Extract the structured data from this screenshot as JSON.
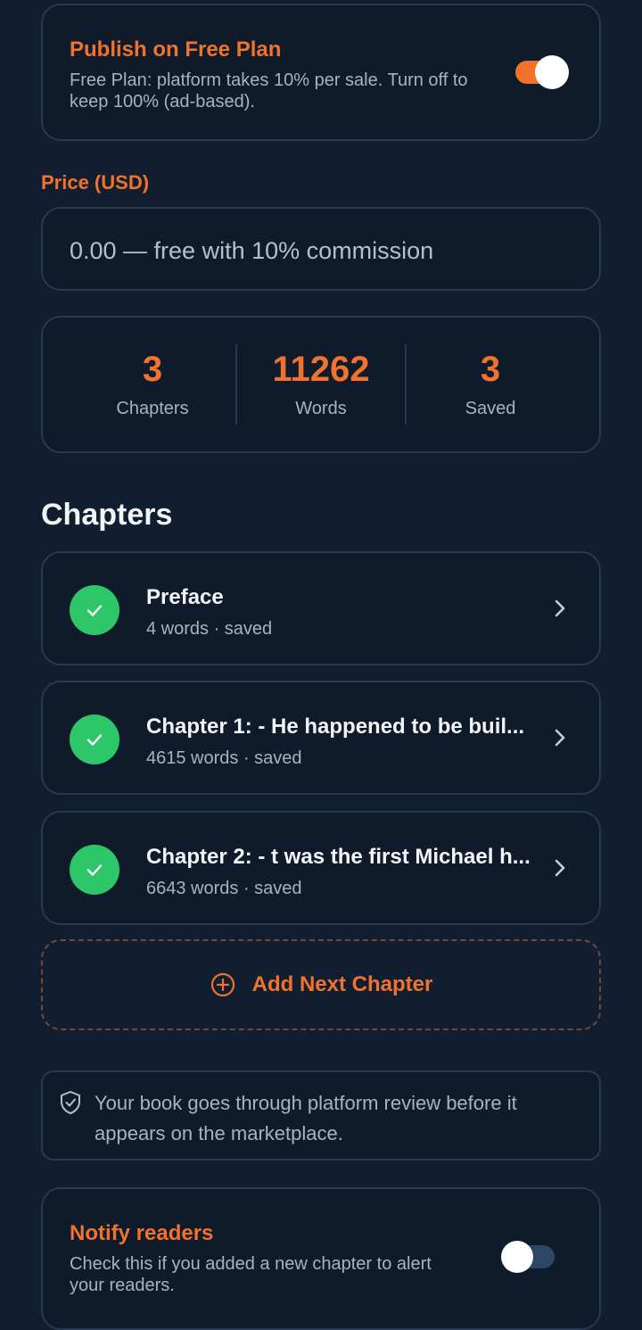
{
  "publish": {
    "title": "Publish on Free Plan",
    "description": "Free Plan: platform takes 10% per sale. Turn off to keep 100% (ad-based).",
    "enabled": true
  },
  "price": {
    "label": "Price (USD)",
    "placeholder": "0.00 — free with 10% commission"
  },
  "stats": [
    {
      "value": "3",
      "label": "Chapters"
    },
    {
      "value": "11262",
      "label": "Words"
    },
    {
      "value": "3",
      "label": "Saved"
    }
  ],
  "chapters_heading": "Chapters",
  "chapters": [
    {
      "title": "Preface",
      "meta": "4 words · saved"
    },
    {
      "title": "Chapter 1: - He happened to be buil...",
      "meta": "4615 words · saved"
    },
    {
      "title": "Chapter 2: - t was the first Michael h...",
      "meta": "6643 words · saved"
    }
  ],
  "add_chapter_label": "Add Next Chapter",
  "review_notice": "Your book goes through platform review before it appears on the marketplace.",
  "notify": {
    "title": "Notify readers",
    "description": "Check this if you added a new chapter to alert your readers.",
    "enabled": false
  },
  "colors": {
    "background": "#111e30",
    "card": "#0f1a2b",
    "accent": "#f0722d",
    "success": "#2dc76a"
  },
  "icons": {
    "check": "check-icon",
    "chevron": "chevron-right-icon",
    "add": "plus-circle-icon",
    "shield": "shield-check-icon"
  }
}
